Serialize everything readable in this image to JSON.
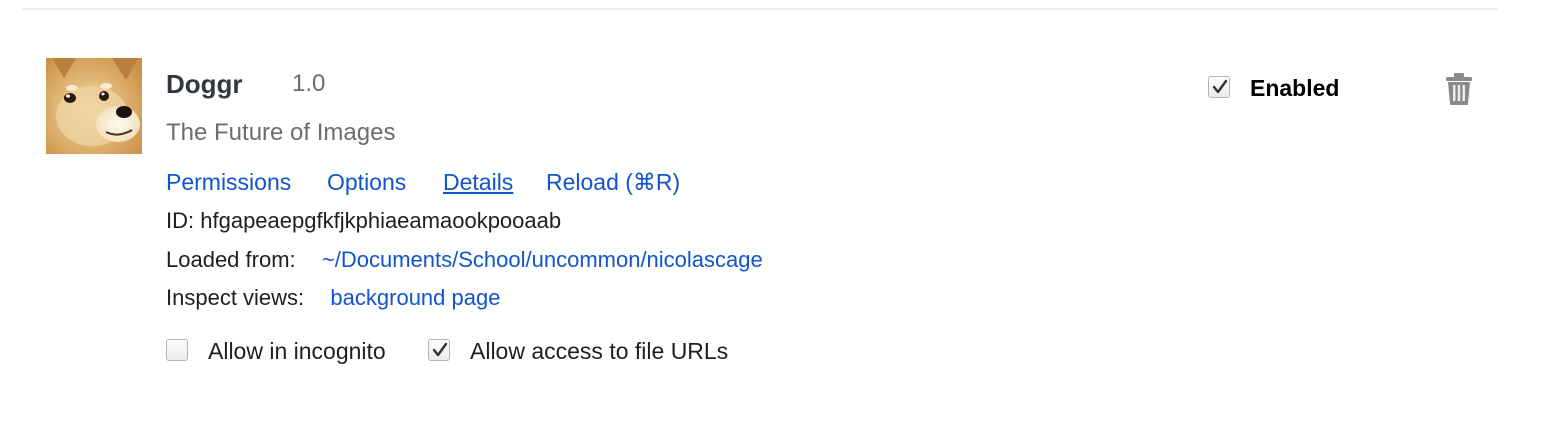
{
  "extension": {
    "name": "Doggr",
    "version": "1.0",
    "description": "The Future of Images",
    "icon": "doge-icon",
    "links": {
      "permissions": "Permissions",
      "options": "Options",
      "details": "Details",
      "reload": "Reload (⌘R)"
    },
    "id_label": "ID:",
    "id_value": "hfgapeaepgfkfjkphiaeamaookpooaab",
    "loaded_from_label": "Loaded from:",
    "loaded_from_value": "~/Documents/School/uncommon/nicolascage",
    "inspect_views_label": "Inspect views:",
    "inspect_views_value": "background page",
    "allow_incognito_label": "Allow in incognito",
    "allow_incognito_checked": false,
    "allow_file_urls_label": "Allow access to file URLs",
    "allow_file_urls_checked": true,
    "enabled_label": "Enabled",
    "enabled_checked": true
  },
  "colors": {
    "link": "#1155cc",
    "muted_text": "#6d6d6d",
    "title_text": "#303942"
  }
}
